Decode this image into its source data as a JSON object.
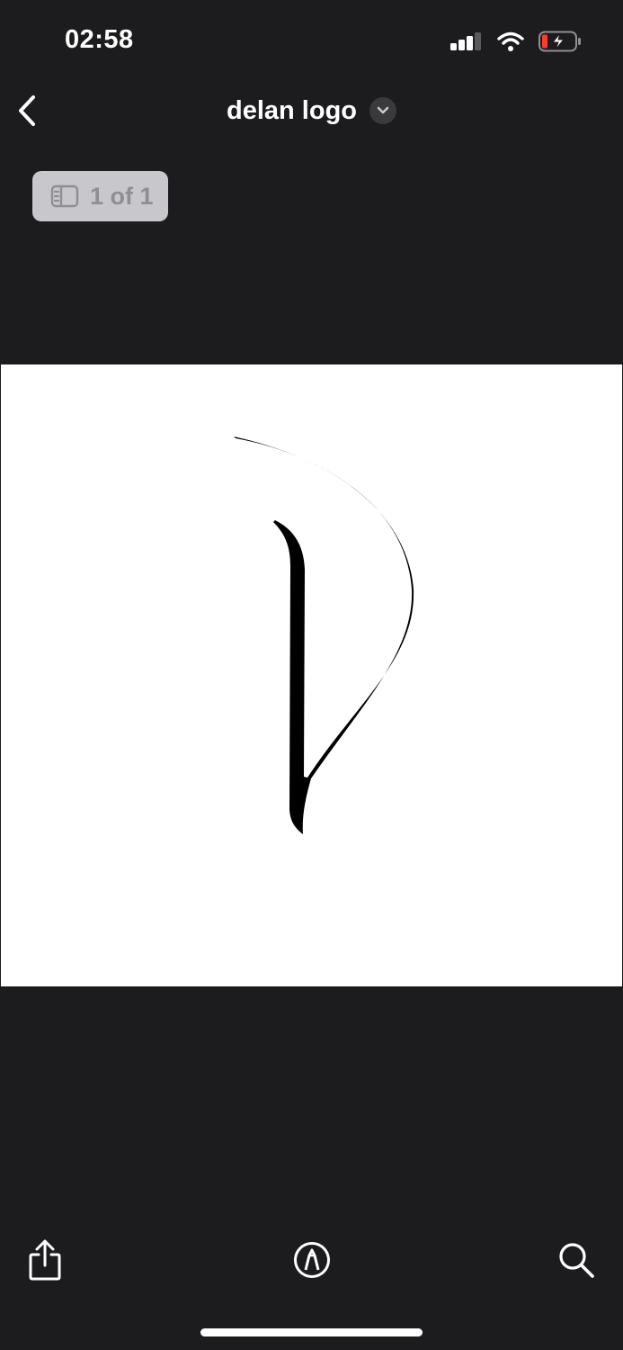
{
  "status_bar": {
    "time": "02:58",
    "signal_icon": "cellular-signal-icon",
    "wifi_icon": "wifi-icon",
    "battery_icon": "battery-charging-low-icon"
  },
  "nav": {
    "back_icon": "chevron-left-icon",
    "title": "delan logo",
    "title_menu_icon": "chevron-down-icon"
  },
  "page_indicator": {
    "icon": "sidebar-thumbnails-icon",
    "label": "1 of 1"
  },
  "document": {
    "content": "handwritten-d-logo"
  },
  "toolbar": {
    "share_icon": "share-icon",
    "markup_icon": "markup-pen-icon",
    "search_icon": "search-icon"
  },
  "colors": {
    "background": "#1c1c1e",
    "page": "#ffffff",
    "ink": "#000000",
    "battery_low": "#ff3b30",
    "indicator_bg": "#c7c7cc"
  }
}
